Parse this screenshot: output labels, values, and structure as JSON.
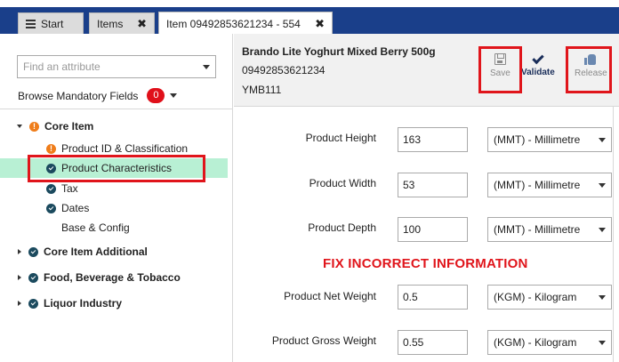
{
  "tabs": [
    {
      "label": "Start",
      "icon": "menu-icon"
    },
    {
      "label": "Items",
      "close": "✖"
    },
    {
      "label": "Item 09492853621234 - 554",
      "close": "✖"
    }
  ],
  "sidebar": {
    "search_placeholder": "Find an attribute",
    "browse_label": "Browse Mandatory Fields",
    "mandatory_count": "0",
    "tree": [
      {
        "label": "Core Item",
        "status": "warning",
        "expanded": true
      },
      {
        "label": "Product ID & Classification",
        "status": "warning"
      },
      {
        "label": "Product Characteristics",
        "status": "ok",
        "selected": true
      },
      {
        "label": "Tax",
        "status": "ok"
      },
      {
        "label": "Dates",
        "status": "ok"
      },
      {
        "label": "Base & Config",
        "status": "none"
      },
      {
        "label": "Core Item Additional",
        "status": "ok",
        "expanded": false
      },
      {
        "label": "Food, Beverage & Tobacco",
        "status": "ok",
        "expanded": false
      },
      {
        "label": "Liquor Industry",
        "status": "ok",
        "expanded": false
      }
    ]
  },
  "header": {
    "title": "Brando Lite Yoghurt Mixed Berry 500g",
    "gtin": "09492853621234",
    "code": "YMB111",
    "save_label": "Save",
    "validate_label": "Validate",
    "release_label": "Release"
  },
  "annotation": "FIX INCORRECT INFORMATION",
  "fields": [
    {
      "label": "Product Height",
      "value": "163",
      "unit": "(MMT) - Millimetre"
    },
    {
      "label": "Product Width",
      "value": "53",
      "unit": "(MMT) - Millimetre"
    },
    {
      "label": "Product Depth",
      "value": "100",
      "unit": "(MMT) - Millimetre"
    },
    {
      "label": "Product Net Weight",
      "value": "0.5",
      "unit": "(KGM) - Kilogram"
    },
    {
      "label": "Product Gross Weight",
      "value": "0.55",
      "unit": "(KGM) - Kilogram"
    }
  ],
  "colors": {
    "tab_bar": "#1a3f8a",
    "selected_row": "#b8f0d4",
    "highlight_box": "#e0151b",
    "badge": "#e0101a",
    "warning": "#ef7d1a",
    "ok": "#1b4a5e"
  }
}
